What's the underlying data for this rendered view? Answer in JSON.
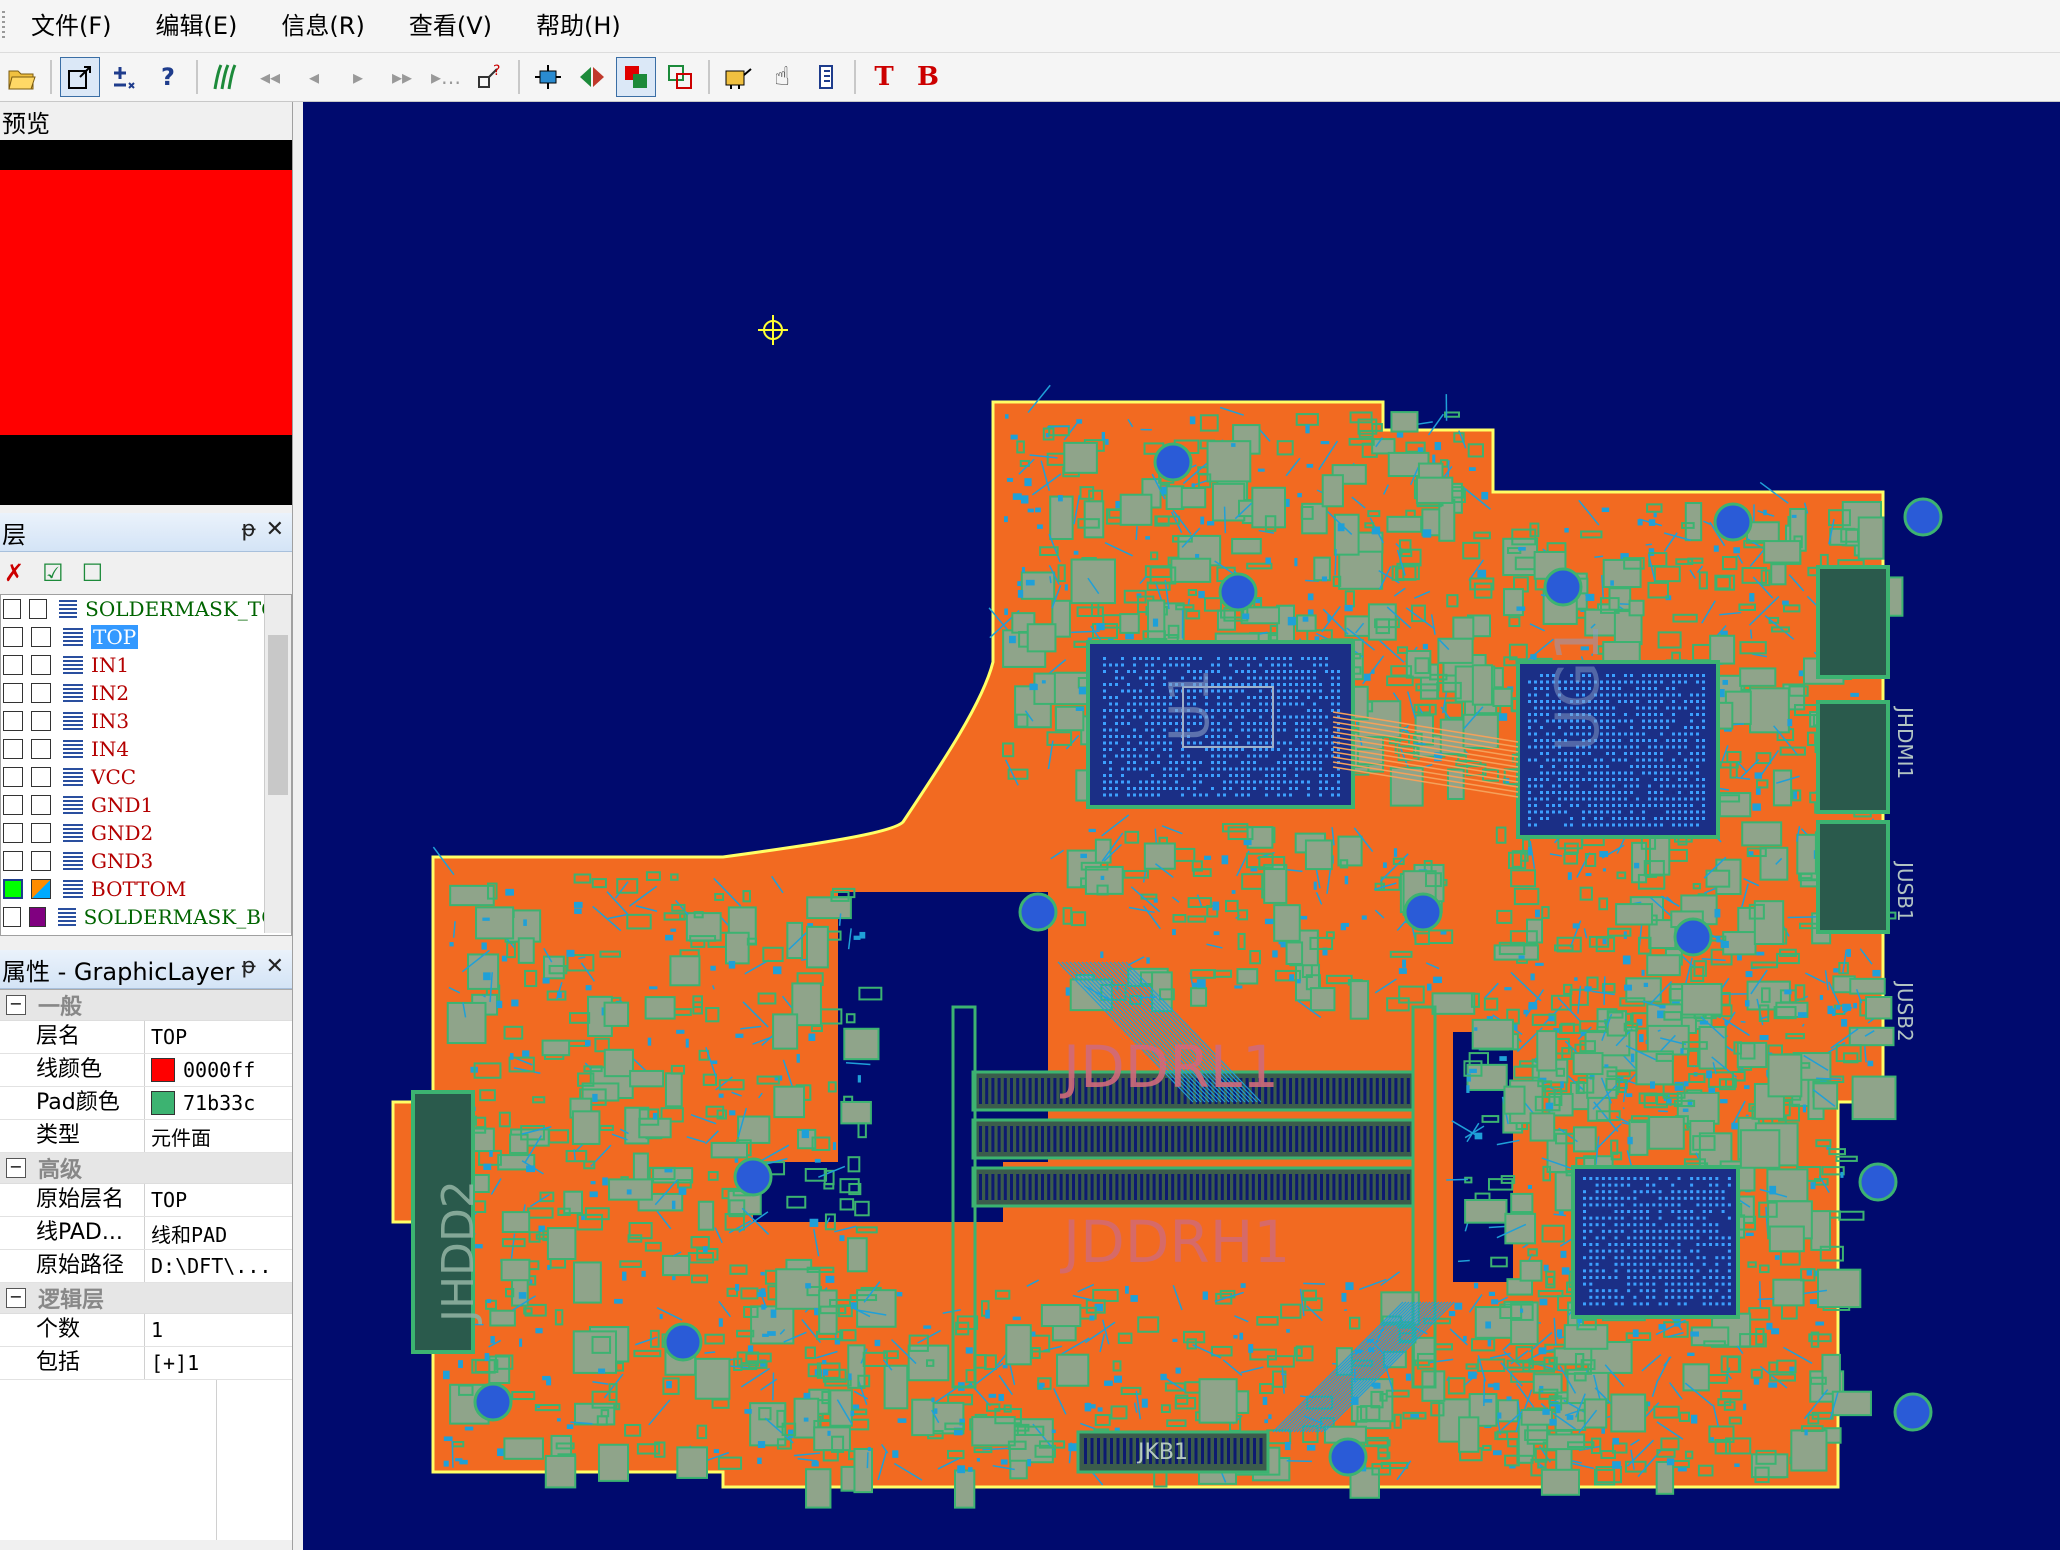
{
  "menu": [
    "文件(F)",
    "编辑(E)",
    "信息(R)",
    "查看(V)",
    "帮助(H)"
  ],
  "toolbar": {
    "question_label": "?",
    "text_top_label": "T",
    "text_bottom_label": "B"
  },
  "preview": {
    "title": "预览"
  },
  "layers_panel": {
    "title": "层",
    "pin": "ᵽ",
    "close": "✕",
    "tools": {
      "clear": "✗",
      "check_all": "☑",
      "uncheck_all": "☐"
    },
    "items": [
      {
        "name": "SOLDERMASK_TOP",
        "selected": false
      },
      {
        "name": "TOP",
        "selected": true
      },
      {
        "name": "IN1",
        "selected": false
      },
      {
        "name": "IN2",
        "selected": false
      },
      {
        "name": "IN3",
        "selected": false
      },
      {
        "name": "IN4",
        "selected": false
      },
      {
        "name": "VCC",
        "selected": false
      },
      {
        "name": "GND1",
        "selected": false
      },
      {
        "name": "GND2",
        "selected": false
      },
      {
        "name": "GND3",
        "selected": false
      },
      {
        "name": "BOTTOM",
        "selected": false
      },
      {
        "name": "SOLDERMASK_BOT",
        "selected": false
      }
    ]
  },
  "properties_panel": {
    "title": "属性 - GraphicLayer",
    "pin": "ᵽ",
    "close": "✕",
    "categories": [
      {
        "name": "一般",
        "rows": [
          {
            "key": "层名",
            "value": "TOP"
          },
          {
            "key": "线颜色",
            "value": "0000ff",
            "swatch": "#ff0000"
          },
          {
            "key": "Pad颜色",
            "value": "71b33c",
            "swatch": "#3cb371"
          },
          {
            "key": "类型",
            "value": "元件面"
          }
        ]
      },
      {
        "name": "高级",
        "rows": [
          {
            "key": "原始层名",
            "value": "TOP"
          },
          {
            "key": "线PAD...",
            "value": "线和PAD"
          },
          {
            "key": "原始路径",
            "value": "D:\\DFT\\..."
          }
        ]
      },
      {
        "name": "逻辑层",
        "rows": [
          {
            "key": "个数",
            "value": "1"
          },
          {
            "key": "包括",
            "value": "[+]1"
          }
        ]
      }
    ]
  },
  "board": {
    "labels": [
      "JDDRL1",
      "JDDRH1",
      "JHDD2",
      "JKB1",
      "JUSB1",
      "JUSB2",
      "JHDMI1",
      "U1",
      "UG1"
    ],
    "colors": {
      "background": "#000a6e",
      "copper": "#f26a21",
      "pad": "#3cb371",
      "outline": "#ffff66",
      "trace": "#1fa0d8"
    }
  }
}
